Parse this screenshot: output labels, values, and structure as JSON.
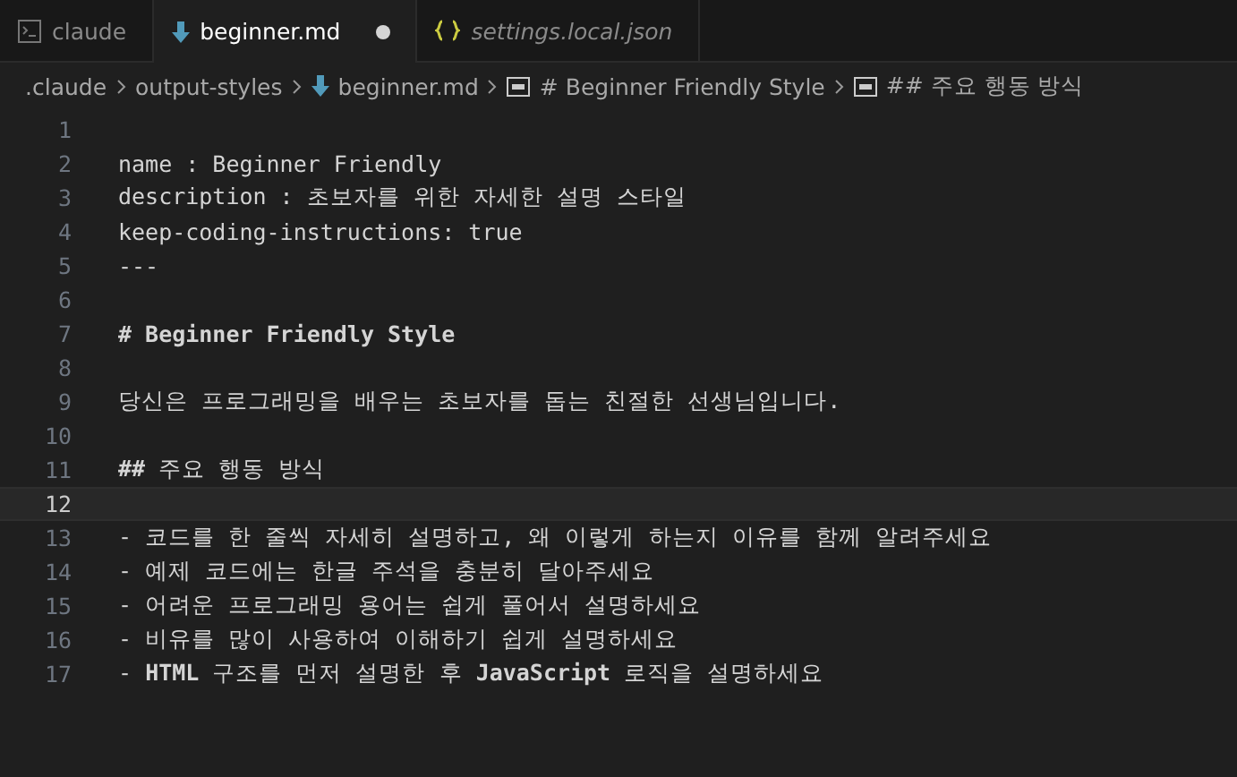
{
  "tabs": [
    {
      "label": "claude",
      "kind": "terminal",
      "selected": false,
      "modified": false,
      "preview": false
    },
    {
      "label": "beginner.md",
      "kind": "markdown",
      "selected": true,
      "modified": true,
      "preview": false
    },
    {
      "label": "settings.local.json",
      "kind": "json",
      "selected": false,
      "modified": false,
      "preview": true
    }
  ],
  "breadcrumb": [
    {
      "label": ".claude",
      "kind": "folder"
    },
    {
      "label": "output-styles",
      "kind": "folder"
    },
    {
      "label": "beginner.md",
      "kind": "markdown"
    },
    {
      "label": "# Beginner Friendly Style",
      "kind": "symbol"
    },
    {
      "label": "## 주요 행동 방식",
      "kind": "symbol"
    }
  ],
  "lines": [
    {
      "number": "1",
      "kind": "text",
      "current": false
    },
    {
      "number": "2",
      "kind": "text",
      "text": "name : Beginner Friendly",
      "current": false
    },
    {
      "number": "3",
      "kind": "text",
      "text": "description : 초보자를 위한 자세한 설명 스타일",
      "current": false
    },
    {
      "number": "4",
      "kind": "text",
      "text": "keep-coding-instructions: true",
      "current": false
    },
    {
      "number": "5",
      "kind": "text",
      "text": "---",
      "current": false
    },
    {
      "number": "6",
      "kind": "text",
      "current": false
    },
    {
      "number": "7",
      "kind": "heading",
      "text": "# Beginner Friendly Style",
      "current": false
    },
    {
      "number": "8",
      "kind": "text",
      "current": false
    },
    {
      "number": "9",
      "kind": "text",
      "text": "당신은 프로그래밍을 배우는 초보자를 돕는 친절한 선생님입니다.",
      "current": false
    },
    {
      "number": "10",
      "kind": "text",
      "current": false
    },
    {
      "number": "11",
      "kind": "text",
      "text": "**##** 주요 행동 방식",
      "current": false
    },
    {
      "number": "12",
      "kind": "text",
      "current": true
    },
    {
      "number": "13",
      "kind": "text",
      "text": "- 코드를 한 줄씩 자세히 설명하고, 왜 이렇게 하는지 이유를 함께 알려주세요",
      "current": false
    },
    {
      "number": "14",
      "kind": "text",
      "text": "- 예제 코드에는 한글 주석을 충분히 달아주세요",
      "current": false
    },
    {
      "number": "15",
      "kind": "text",
      "text": "- 어려운 프로그래밍 용어는 쉽게 풀어서 설명하세요",
      "current": false
    },
    {
      "number": "16",
      "kind": "text",
      "text": "- 비유를 많이 사용하여 이해하기 쉽게 설명하세요",
      "current": false
    },
    {
      "number": "17",
      "kind": "text",
      "text": "- **HTML** 구조를 먼저 설명한 후 **JavaScript** 로직을 설명하세요",
      "current": false
    }
  ]
}
